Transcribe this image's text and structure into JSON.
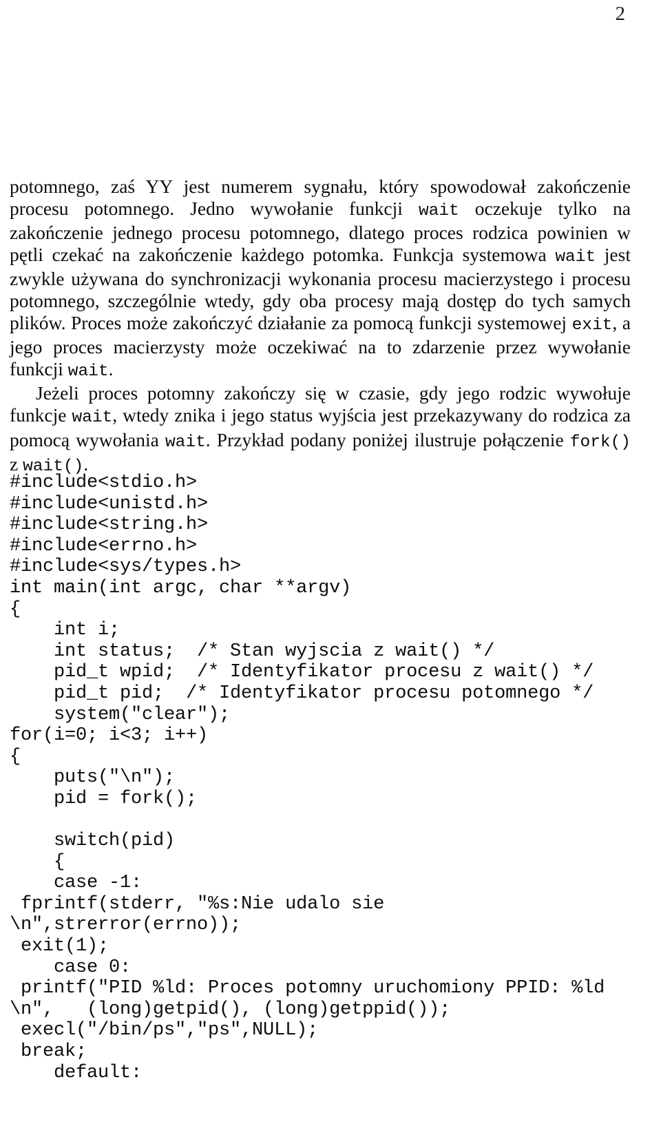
{
  "document": {
    "page_number": "2",
    "language": "pl"
  },
  "paragraphs": [
    {
      "id": "para-wait-description",
      "indent": false,
      "runs": [
        {
          "type": "text",
          "text": "potomnego, zaś YY jest numerem sygnału, który spowodował zakończenie procesu potomnego. Jedno wywołanie funkcji "
        },
        {
          "type": "code",
          "text": "wait"
        },
        {
          "type": "text",
          "text": " oczekuje tylko na zakończenie jednego procesu potomnego, dlatego proces rodzica powinien w pętli czekać na zakończenie każdego potomka. Funkcja systemowa "
        },
        {
          "type": "code",
          "text": "wait"
        },
        {
          "type": "text",
          "text": " jest zwykle używana do synchronizacji wykonania procesu macierzystego i procesu potomnego, szczególnie wtedy, gdy oba procesy mają dostęp do tych samych plików. Proces może zakończyć działanie za pomocą funkcji systemowej "
        },
        {
          "type": "code",
          "text": "exit"
        },
        {
          "type": "text",
          "text": ", a jego proces macierzysty może oczekiwać na to zdarzenie przez wywołanie funkcji "
        },
        {
          "type": "code",
          "text": "wait"
        },
        {
          "type": "text",
          "text": "."
        }
      ]
    },
    {
      "id": "para-child-exit",
      "indent": true,
      "runs": [
        {
          "type": "text",
          "text": "Jeżeli proces potomny zakończy się w czasie, gdy jego rodzic wywołuje funkcje "
        },
        {
          "type": "code",
          "text": "wait"
        },
        {
          "type": "text",
          "text": ", wtedy znika i jego status wyjścia jest przekazywany do rodzica za pomocą wywołania "
        },
        {
          "type": "code",
          "text": "wait"
        },
        {
          "type": "text",
          "text": ". Przykład podany poniżej ilustruje połączenie "
        },
        {
          "type": "code",
          "text": "fork()"
        },
        {
          "type": "text",
          "text": " z "
        },
        {
          "type": "code",
          "text": "wait()"
        },
        {
          "type": "text",
          "text": "."
        }
      ]
    }
  ],
  "code_listing": {
    "language": "c",
    "lines": [
      "#include<stdio.h>",
      "#include<unistd.h>",
      "#include<string.h>",
      "#include<errno.h>",
      "#include<sys/types.h>",
      "int main(int argc, char **argv)",
      "{",
      "    int i;",
      "    int status;  /* Stan wyjscia z wait() */",
      "    pid_t wpid;  /* Identyfikator procesu z wait() */",
      "    pid_t pid;  /* Identyfikator procesu potomnego */",
      "    system(\"clear\");",
      "for(i=0; i<3; i++)",
      "{",
      "    puts(\"\\n\");",
      "    pid = fork();",
      "",
      "    switch(pid)",
      "    {",
      "    case -1:",
      " fprintf(stderr, \"%s:Nie udalo sie",
      "\\n\",strerror(errno));",
      " exit(1);",
      "    case 0:",
      " printf(\"PID %ld: Proces potomny uruchomiony PPID: %ld",
      "\\n\",   (long)getpid(), (long)getppid());",
      " execl(\"/bin/ps\",\"ps\",NULL);",
      " break;",
      "    default:"
    ]
  }
}
